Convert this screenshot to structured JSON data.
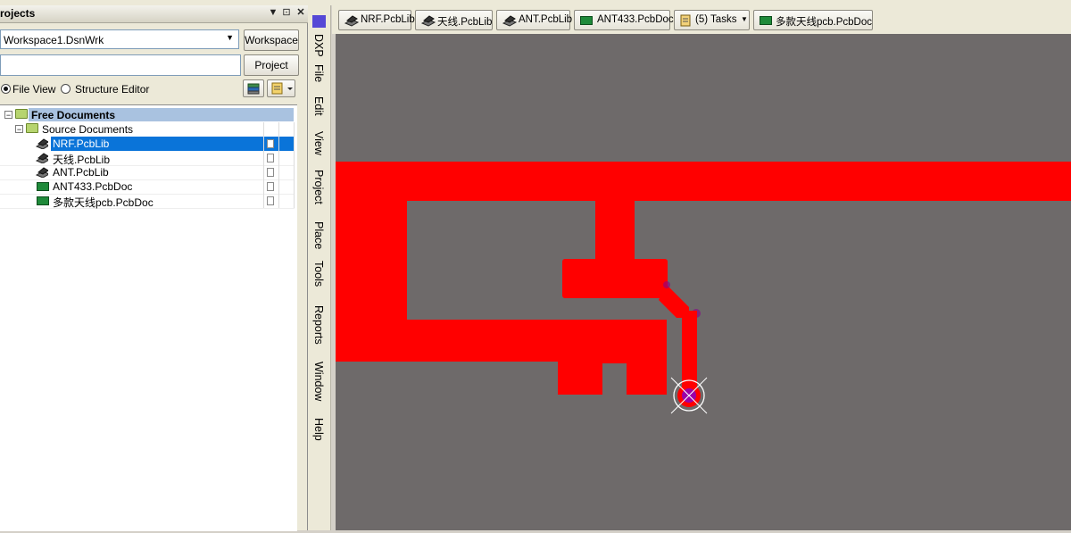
{
  "panel": {
    "title": "Projects",
    "title_visible": "rojects",
    "workspace_combo": "Workspace1.DsnWrk",
    "workspace_button": "Workspace",
    "project_field": "",
    "project_button": "Project",
    "view_options": [
      {
        "label": "File View",
        "selected": true
      },
      {
        "label": "Structure Editor",
        "selected": false
      }
    ]
  },
  "tree": {
    "root": "Free Documents",
    "group": "Source Documents",
    "items": [
      {
        "label": "NRF.PcbLib",
        "type": "pcblib",
        "selected": true
      },
      {
        "label": "天线.PcbLib",
        "type": "pcblib",
        "selected": false
      },
      {
        "label": "ANT.PcbLib",
        "type": "pcblib",
        "selected": false
      },
      {
        "label": "ANT433.PcbDoc",
        "type": "pcbdoc",
        "selected": false
      },
      {
        "label": "多款天线pcb.PcbDoc",
        "type": "pcbdoc",
        "selected": false
      }
    ]
  },
  "menu": [
    "DXP",
    "File",
    "Edit",
    "View",
    "Project",
    "Place",
    "Tools",
    "Reports",
    "Window",
    "Help"
  ],
  "doc_tabs": [
    {
      "label": "NRF.PcbLib",
      "icon": "pcblib-icon"
    },
    {
      "label": "天线.PcbLib",
      "icon": "pcblib-icon"
    },
    {
      "label": "ANT.PcbLib",
      "icon": "pcblib-icon"
    },
    {
      "label": "ANT433.PcbDoc",
      "icon": "pcbdoc-icon"
    },
    {
      "label": "(5) Tasks",
      "icon": "tasks-icon"
    },
    {
      "label": "多款天线pcb.PcbDoc",
      "icon": "pcbdoc-icon"
    }
  ],
  "colors": {
    "canvas_bg": "#6e6a6a",
    "copper": "#ff0000",
    "via_ring": "#8b008b",
    "selection": "#0a74d9",
    "tree_header": "#a9c2e0"
  }
}
